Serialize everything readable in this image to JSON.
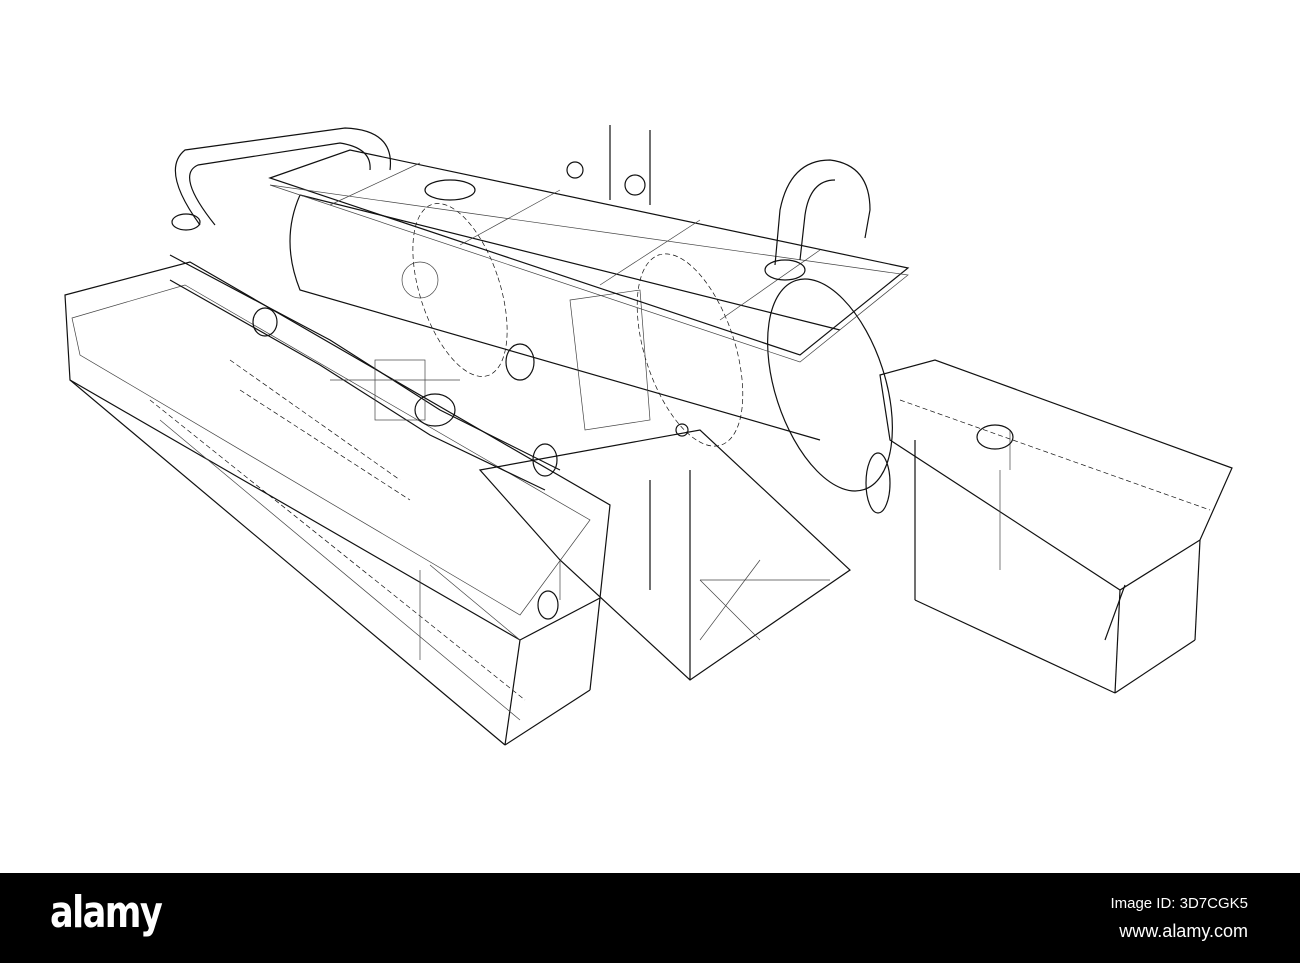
{
  "image": {
    "subject": "wireframe drawing"
  },
  "footer": {
    "logo": "alamy",
    "image_id": "Image ID: 3D7CGK5",
    "website": "www.alamy.com"
  }
}
